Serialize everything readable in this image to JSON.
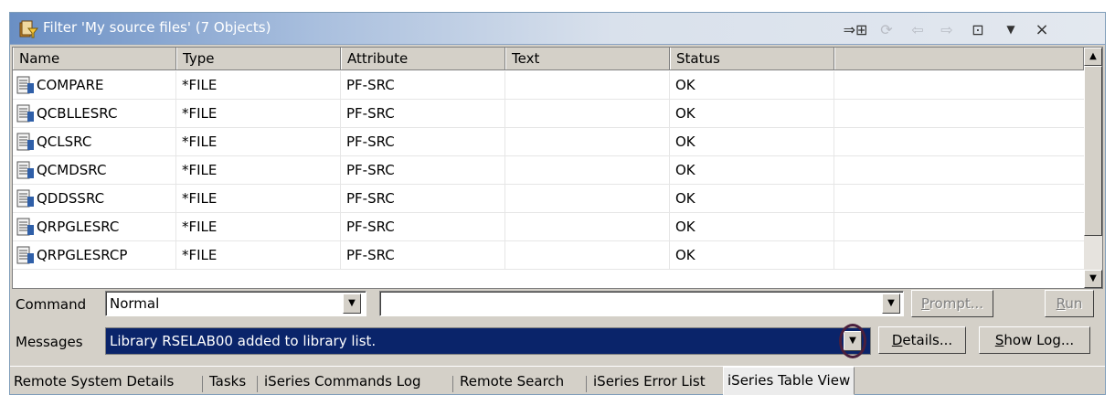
{
  "window": {
    "title": "Filter 'My source files' (7 Objects)",
    "toolbar_icons": [
      "link-with-editor-icon",
      "refresh-icon",
      "back-icon",
      "forward-icon",
      "up-level-icon",
      "view-menu-icon",
      "close-icon"
    ]
  },
  "table": {
    "columns": [
      "Name",
      "Type",
      "Attribute",
      "Text",
      "Status"
    ],
    "rows": [
      {
        "name": "COMPARE",
        "type": "*FILE",
        "attribute": "PF-SRC",
        "text": "",
        "status": "OK"
      },
      {
        "name": "QCBLLESRC",
        "type": "*FILE",
        "attribute": "PF-SRC",
        "text": "",
        "status": "OK"
      },
      {
        "name": "QCLSRC",
        "type": "*FILE",
        "attribute": "PF-SRC",
        "text": "",
        "status": "OK"
      },
      {
        "name": "QCMDSRC",
        "type": "*FILE",
        "attribute": "PF-SRC",
        "text": "",
        "status": "OK"
      },
      {
        "name": "QDDSSRC",
        "type": "*FILE",
        "attribute": "PF-SRC",
        "text": "",
        "status": "OK"
      },
      {
        "name": "QRPGLESRC",
        "type": "*FILE",
        "attribute": "PF-SRC",
        "text": "",
        "status": "OK"
      },
      {
        "name": "QRPGLESRCP",
        "type": "*FILE",
        "attribute": "PF-SRC",
        "text": "",
        "status": "OK"
      }
    ]
  },
  "command": {
    "label": "Command",
    "mode": "Normal",
    "input_value": "",
    "prompt_button": "Prompt...",
    "run_button": "Run"
  },
  "messages": {
    "label": "Messages",
    "value": "Library RSELAB00 added to library list.",
    "details_button": "Details...",
    "show_log_button": "Show Log..."
  },
  "tabs": [
    {
      "label": "Remote System Details",
      "active": false
    },
    {
      "label": "Tasks",
      "active": false
    },
    {
      "label": "iSeries Commands Log",
      "active": false
    },
    {
      "label": "Remote Search",
      "active": false
    },
    {
      "label": "iSeries Error List",
      "active": false
    },
    {
      "label": "iSeries Table View",
      "active": true
    }
  ]
}
